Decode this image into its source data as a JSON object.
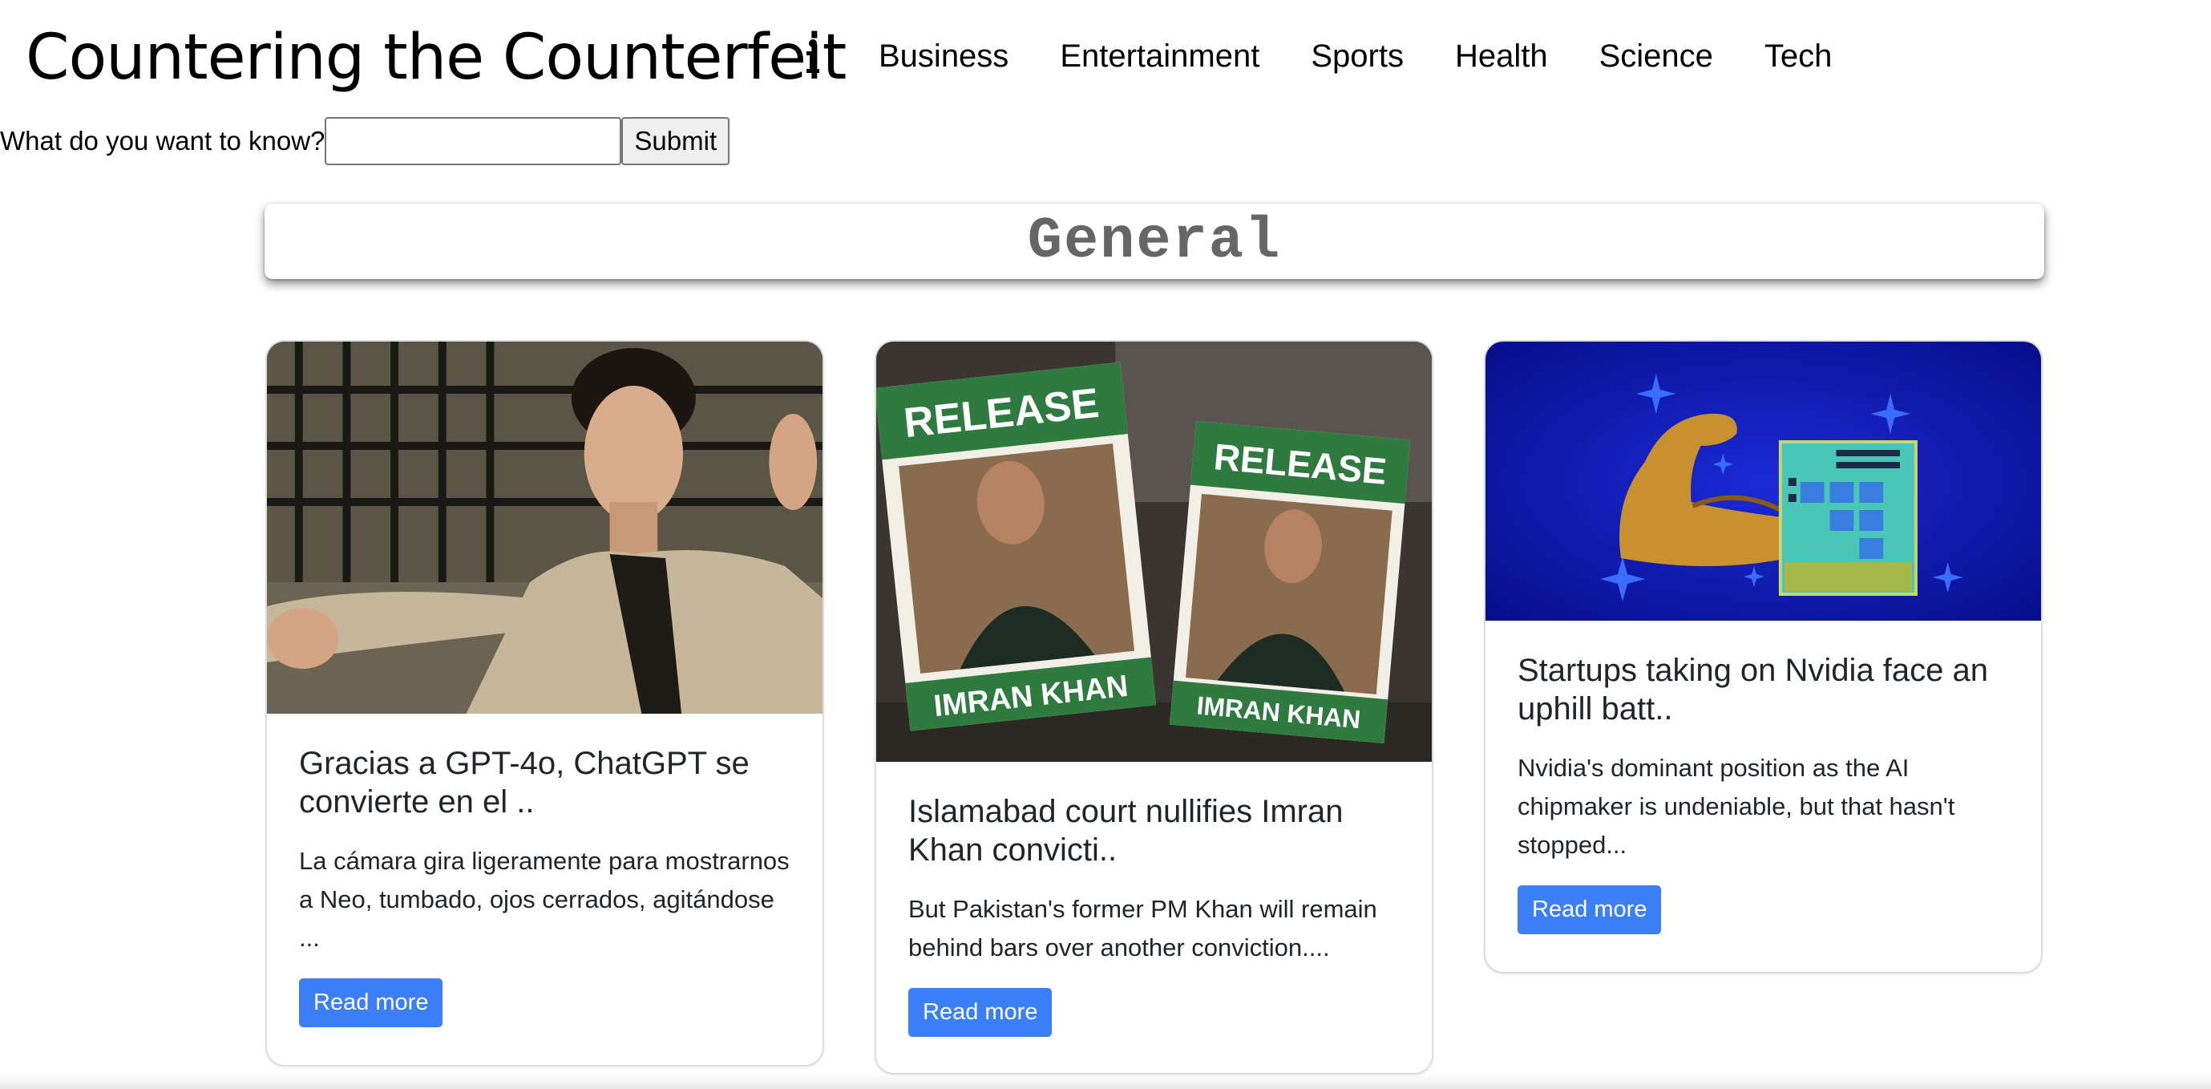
{
  "header": {
    "title": "Countering the Counterfeit",
    "info_icon": "info-icon",
    "nav": [
      "Business",
      "Entertainment",
      "Sports",
      "Health",
      "Science",
      "Tech"
    ]
  },
  "search": {
    "label": "What do you want to know?",
    "value": "",
    "placeholder": "",
    "submit_label": "Submit"
  },
  "category": {
    "title": "General"
  },
  "articles": [
    {
      "image": "matrix-neo-photo",
      "title": "Gracias a GPT-4o, ChatGPT se convierte en el ..",
      "description": "La cámara gira ligeramente para mostrarnos a Neo, tumbado, ojos cerrados, agitándose ...",
      "button": "Read more"
    },
    {
      "image": "imran-khan-protest-signs-photo",
      "image_text": [
        "RELEASE",
        "IMRAN KHAN",
        "RELEASE",
        "IMRAN KHAN"
      ],
      "title": "Islamabad court nullifies Imran Khan convicti..",
      "description": "But Pakistan's former PM Khan will remain behind bars over another conviction....",
      "button": "Read more"
    },
    {
      "image": "muscle-arm-chip-illustration",
      "title": "Startups taking on Nvidia face an uphill batt..",
      "description": "Nvidia's dominant position as the AI chipmaker is undeniable, but that hasn't stopped...",
      "button": "Read more"
    }
  ],
  "colors": {
    "button_bg": "#3b7ef6",
    "button_text": "#ffffff",
    "card_border": "#dcdcdc",
    "category_text": "#666666",
    "illustration_bg": "#0a12b8"
  }
}
